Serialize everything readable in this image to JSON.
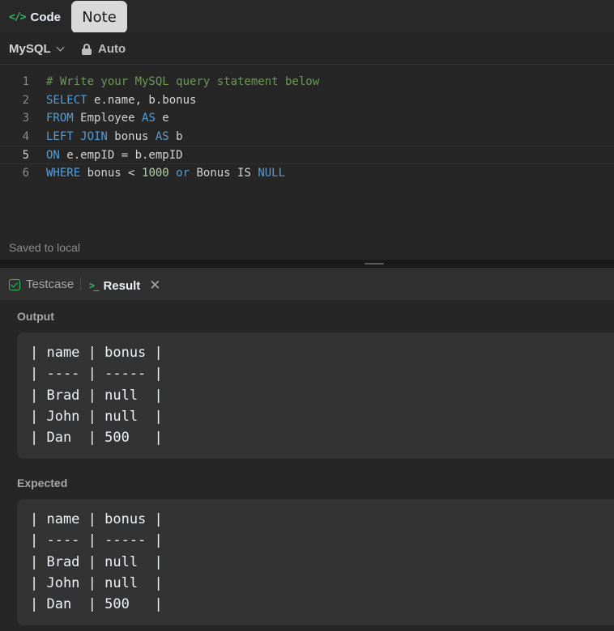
{
  "tabs": {
    "code_label": "Code",
    "code_icon": "code-brackets-icon",
    "note_label": "Note"
  },
  "editor": {
    "language": "MySQL",
    "auto_label": "Auto",
    "lines": [
      {
        "num": "1",
        "parts": [
          {
            "t": "# Write your MySQL query statement below",
            "c": "cm"
          }
        ]
      },
      {
        "num": "2",
        "parts": [
          {
            "t": "SELECT",
            "c": "kw"
          },
          {
            "t": " e.name, b.bonus",
            "c": ""
          }
        ]
      },
      {
        "num": "3",
        "parts": [
          {
            "t": "FROM",
            "c": "kw"
          },
          {
            "t": " Employee ",
            "c": ""
          },
          {
            "t": "AS",
            "c": "kw"
          },
          {
            "t": " e",
            "c": ""
          }
        ]
      },
      {
        "num": "4",
        "parts": [
          {
            "t": "LEFT JOIN",
            "c": "kw"
          },
          {
            "t": " bonus ",
            "c": ""
          },
          {
            "t": "AS",
            "c": "kw"
          },
          {
            "t": " b",
            "c": ""
          }
        ]
      },
      {
        "num": "5",
        "parts": [
          {
            "t": "ON",
            "c": "kw"
          },
          {
            "t": " e.empID = b.empID",
            "c": ""
          }
        ]
      },
      {
        "num": "6",
        "parts": [
          {
            "t": "WHERE",
            "c": "kw"
          },
          {
            "t": " bonus < ",
            "c": ""
          },
          {
            "t": "1000",
            "c": "num"
          },
          {
            "t": " ",
            "c": ""
          },
          {
            "t": "or",
            "c": "kw"
          },
          {
            "t": " Bonus IS ",
            "c": ""
          },
          {
            "t": "NULL",
            "c": "kw"
          }
        ]
      }
    ],
    "status": "Saved to local"
  },
  "results": {
    "testcase_label": "Testcase",
    "result_label": "Result",
    "output_label": "Output",
    "output_rows": [
      "| name | bonus |",
      "| ---- | ----- |",
      "| Brad | null  |",
      "| John | null  |",
      "| Dan  | 500   |"
    ],
    "expected_label": "Expected",
    "expected_rows": [
      "| name | bonus |",
      "| ---- | ----- |",
      "| Brad | null  |",
      "| John | null  |",
      "| Dan  | 500   |"
    ]
  },
  "colors": {
    "accent_green": "#2cbb5d",
    "keyword_blue": "#569cd6",
    "comment_green": "#6a9955",
    "number_green": "#b5cea8"
  }
}
